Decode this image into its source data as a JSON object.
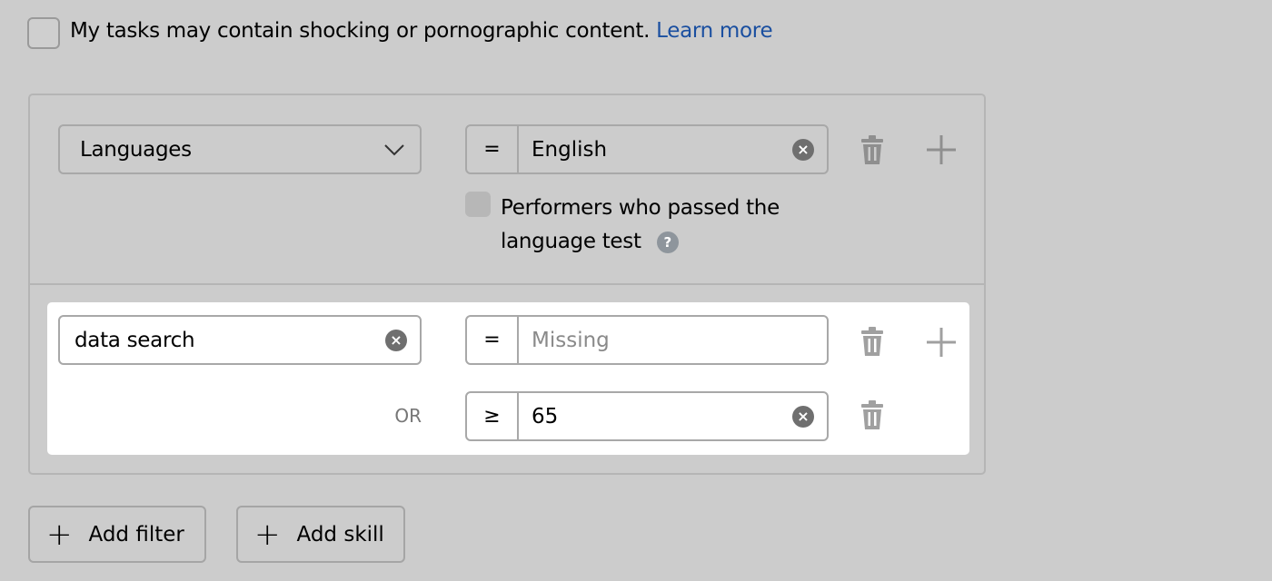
{
  "consent": {
    "label": "My tasks may contain shocking or pornographic content.",
    "link": "Learn more",
    "checked": false
  },
  "filters": [
    {
      "field": "Languages",
      "conditions": [
        {
          "operator": "=",
          "value": "English",
          "placeholder": ""
        }
      ],
      "language_test": {
        "label_line1": "Performers who passed the",
        "label_line2": "language test",
        "checked": false
      }
    },
    {
      "field": "data search",
      "conditions": [
        {
          "operator": "=",
          "value": "",
          "placeholder": "Missing"
        },
        {
          "connector": "OR",
          "operator": "≥",
          "value": "65",
          "placeholder": ""
        }
      ]
    }
  ],
  "buttons": {
    "add_filter": "Add filter",
    "add_skill": "Add skill"
  },
  "icons": {
    "clear": "×",
    "help": "?"
  }
}
